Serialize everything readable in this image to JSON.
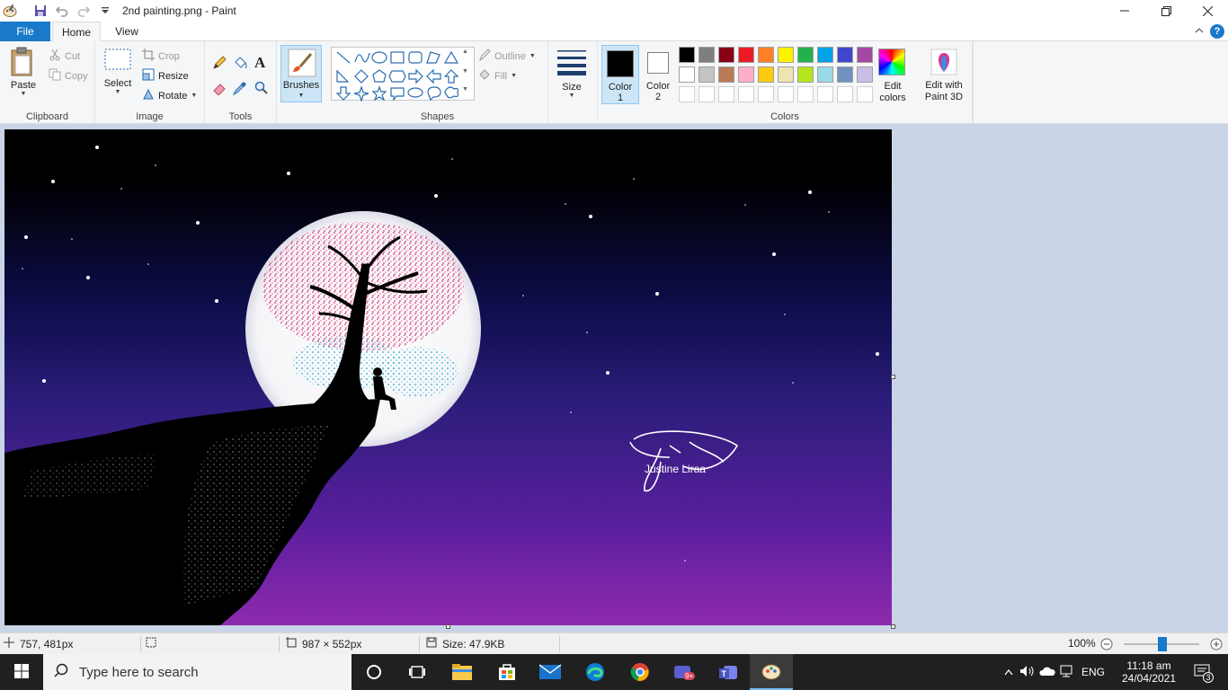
{
  "titlebar": {
    "title": "2nd painting.png - Paint",
    "app_icon": "paint-palette-icon",
    "quick_access": [
      "save-icon",
      "undo-icon",
      "redo-icon",
      "customize-dropdown-icon"
    ],
    "controls": [
      "minimize-icon",
      "restore-icon",
      "close-icon"
    ]
  },
  "tabs": {
    "file": "File",
    "home": "Home",
    "view": "View",
    "help": "?"
  },
  "ribbon": {
    "clipboard": {
      "label": "Clipboard",
      "paste": "Paste",
      "cut": "Cut",
      "copy": "Copy"
    },
    "image": {
      "label": "Image",
      "select": "Select",
      "crop": "Crop",
      "resize": "Resize",
      "rotate": "Rotate"
    },
    "tools": {
      "label": "Tools",
      "items": [
        "pencil-icon",
        "fill-bucket-icon",
        "text-icon",
        "eraser-icon",
        "color-picker-icon",
        "magnifier-icon"
      ]
    },
    "brushes": {
      "label": "Brushes"
    },
    "shapes": {
      "label": "Shapes",
      "outline": "Outline",
      "fill": "Fill"
    },
    "size": {
      "label": "Size"
    },
    "colors": {
      "label": "Colors",
      "color1_label": "Color",
      "color1_num": "1",
      "color2_label": "Color",
      "color2_num": "2",
      "color1": "#000000",
      "color2": "#ffffff",
      "edit_colors": "Edit colors",
      "palette_row1": [
        "#000000",
        "#7f7f7f",
        "#880015",
        "#ed1c24",
        "#ff7f27",
        "#fff200",
        "#22b14c",
        "#00a2e8",
        "#3f48cc",
        "#a349a4"
      ],
      "palette_row2": [
        "#ffffff",
        "#c3c3c3",
        "#b97a57",
        "#ffaec9",
        "#ffc90e",
        "#efe4b0",
        "#b5e61d",
        "#99d9ea",
        "#7092be",
        "#c8bfe7"
      ]
    },
    "paint3d": {
      "label": "Edit with Paint 3D"
    }
  },
  "canvas": {
    "signature_text": "Justine Liraa"
  },
  "status": {
    "cursor_pos": "757, 481px",
    "image_size": "987 × 552px",
    "file_size": "Size: 47.9KB",
    "zoom": "100%"
  },
  "taskbar": {
    "search_placeholder": "Type here to search",
    "apps": [
      "cortana-icon",
      "task-view-icon",
      "file-explorer-icon",
      "microsoft-store-icon",
      "mail-icon",
      "edge-icon",
      "chrome-icon",
      "teams-chat-icon",
      "teams-icon",
      "paint-icon"
    ],
    "language": "ENG",
    "time": "11:18 am",
    "date": "24/04/2021",
    "notifications": "3",
    "chat_badge": "9+"
  }
}
